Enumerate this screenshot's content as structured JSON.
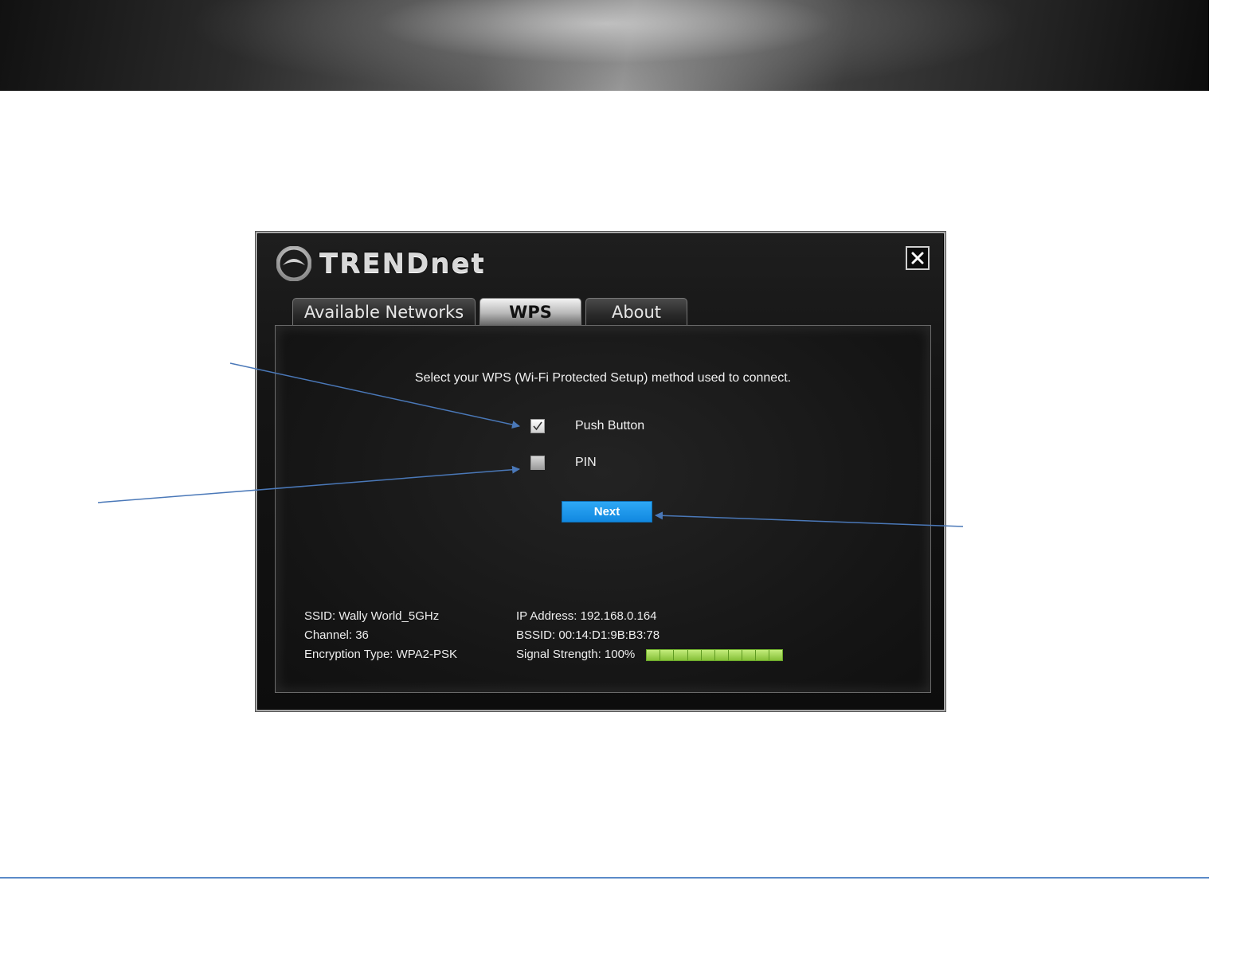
{
  "app": {
    "brand": "TRENDnet",
    "close_icon": "close-icon"
  },
  "tabs": [
    {
      "label": "Available Networks",
      "active": false
    },
    {
      "label": "WPS",
      "active": true
    },
    {
      "label": "About",
      "active": false
    }
  ],
  "wps": {
    "prompt": "Select your WPS (Wi-Fi Protected Setup) method used to connect.",
    "options": [
      {
        "label": "Push Button",
        "checked": true
      },
      {
        "label": "PIN",
        "checked": false
      }
    ],
    "next_label": "Next"
  },
  "status": {
    "ssid": "SSID:  Wally World_5GHz",
    "channel": "Channel:  36",
    "encryption": "Encryption Type:  WPA2-PSK",
    "ip_address": "IP Address:  192.168.0.164",
    "bssid": "BSSID: 00:14:D1:9B:B3:78",
    "signal": "Signal Strength:  100%",
    "signal_percent": 100
  },
  "colors": {
    "accent_button": "#1a94e8",
    "signal_green": "#8ec63f",
    "annotation_line": "#4a78b8",
    "footer_rule": "#5b8ac8"
  }
}
